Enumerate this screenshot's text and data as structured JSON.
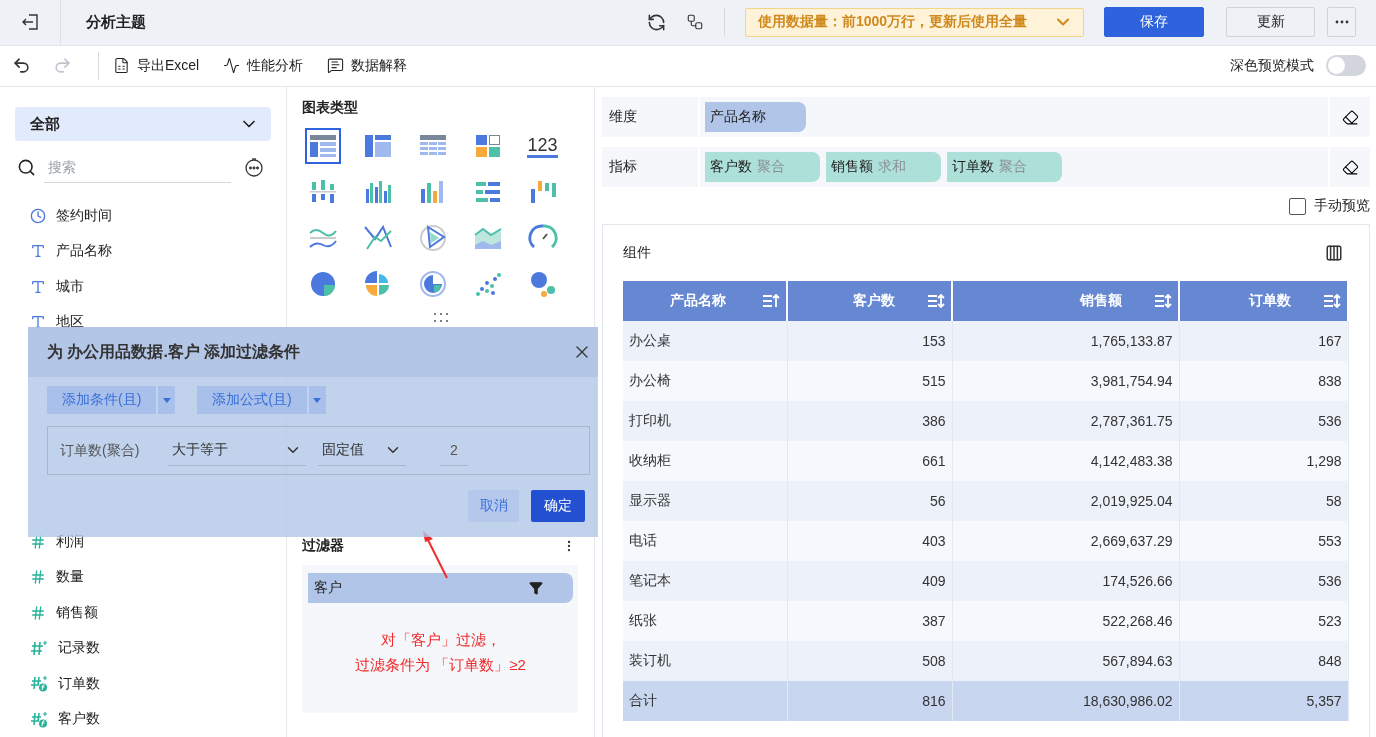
{
  "top_bar": {
    "title": "分析主题",
    "data_notice": "使用数据量：前1000万行，更新后使用全量",
    "buttons": [
      {
        "label": "保存",
        "kind": "primary"
      },
      {
        "label": "更新",
        "kind": "default"
      }
    ]
  },
  "toolbar": {
    "history": [
      {
        "kind": "undo",
        "disabled": false
      },
      {
        "kind": "redo",
        "disabled": true
      }
    ],
    "actions": [
      {
        "label": "导出Excel",
        "kind": "excel"
      },
      {
        "label": "性能分析",
        "kind": "performance"
      },
      {
        "label": "数据解释",
        "kind": "explain"
      }
    ],
    "dark_preview": {
      "label": "深色预览模式",
      "on": false
    }
  },
  "field_panel": {
    "category": "全部",
    "search_placeholder": "搜索",
    "fields_top": [
      {
        "name": "签约时间",
        "kind": "time"
      },
      {
        "name": "产品名称",
        "kind": "text"
      },
      {
        "name": "城市",
        "kind": "text"
      },
      {
        "name": "地区",
        "kind": "text"
      }
    ],
    "fields_bottom": [
      {
        "name": "利润",
        "kind": "number"
      },
      {
        "name": "数量",
        "kind": "number"
      },
      {
        "name": "销售额",
        "kind": "number"
      },
      {
        "name": "记录数",
        "kind": "count"
      },
      {
        "name": "订单数",
        "kind": "calc"
      },
      {
        "name": "客户数",
        "kind": "calc"
      }
    ]
  },
  "chart_panel": {
    "title": "图表类型",
    "chart_types": [
      {
        "kind": "table",
        "selected": true
      },
      {
        "kind": "cross-table",
        "selected": false
      },
      {
        "kind": "detail-table",
        "selected": false
      },
      {
        "kind": "blocks",
        "selected": false
      },
      {
        "kind": "kpi",
        "label": "123",
        "selected": false
      },
      {
        "kind": "split-bar",
        "selected": false
      },
      {
        "kind": "multi-bar",
        "selected": false
      },
      {
        "kind": "color-bar",
        "selected": false
      },
      {
        "kind": "hbar",
        "selected": false
      },
      {
        "kind": "waterfall",
        "selected": false
      },
      {
        "kind": "multi-line",
        "selected": false
      },
      {
        "kind": "line",
        "selected": false
      },
      {
        "kind": "radar",
        "selected": false
      },
      {
        "kind": "area",
        "selected": false
      },
      {
        "kind": "gauge",
        "selected": false
      },
      {
        "kind": "pie",
        "selected": false
      },
      {
        "kind": "rose",
        "selected": false
      },
      {
        "kind": "donut",
        "selected": false
      },
      {
        "kind": "scatter",
        "selected": false
      },
      {
        "kind": "bubble",
        "selected": false
      }
    ]
  },
  "filter_panel": {
    "title": "过滤器",
    "filters": [
      {
        "label": "客户"
      }
    ],
    "annotation": [
      "对「客户」过滤，",
      "过滤条件为 「订单数」≥2"
    ]
  },
  "dialog": {
    "title": "为 办公用品数据.客户 添加过滤条件",
    "add_buttons": [
      "添加条件(且)",
      "添加公式(且)"
    ],
    "condition": {
      "field": "订单数(聚合)",
      "operator": "大于等于",
      "value_type": "固定值",
      "value": "2"
    },
    "buttons": [
      {
        "label": "取消",
        "kind": "secondary"
      },
      {
        "label": "确定",
        "kind": "primary"
      }
    ]
  },
  "config": {
    "dimension": {
      "label": "维度",
      "chips": [
        {
          "name": "产品名称"
        }
      ]
    },
    "measures": {
      "label": "指标",
      "chips": [
        {
          "name": "客户数",
          "agg": "聚合"
        },
        {
          "name": "销售额",
          "agg": "求和"
        },
        {
          "name": "订单数",
          "agg": "聚合"
        }
      ]
    },
    "manual_preview": {
      "label": "手动预览",
      "checked": false
    }
  },
  "component": {
    "title": "组件",
    "table": {
      "columns": [
        {
          "label": "产品名称",
          "sorted": true
        },
        {
          "label": "客户数",
          "sorted": false
        },
        {
          "label": "销售额",
          "sorted": false
        },
        {
          "label": "订单数",
          "sorted": false
        }
      ],
      "rows": [
        [
          "办公桌",
          "153",
          "1,765,133.87",
          "167"
        ],
        [
          "办公椅",
          "515",
          "3,981,754.94",
          "838"
        ],
        [
          "打印机",
          "386",
          "2,787,361.75",
          "536"
        ],
        [
          "收纳柜",
          "661",
          "4,142,483.38",
          "1,298"
        ],
        [
          "显示器",
          "56",
          "2,019,925.04",
          "58"
        ],
        [
          "电话",
          "403",
          "2,669,637.29",
          "553"
        ],
        [
          "笔记本",
          "409",
          "174,526.66",
          "536"
        ],
        [
          "纸张",
          "387",
          "522,268.46",
          "523"
        ],
        [
          "装订机",
          "508",
          "567,894.63",
          "848"
        ]
      ],
      "total": [
        "合计",
        "816",
        "18,630,986.02",
        "5,357"
      ]
    }
  }
}
